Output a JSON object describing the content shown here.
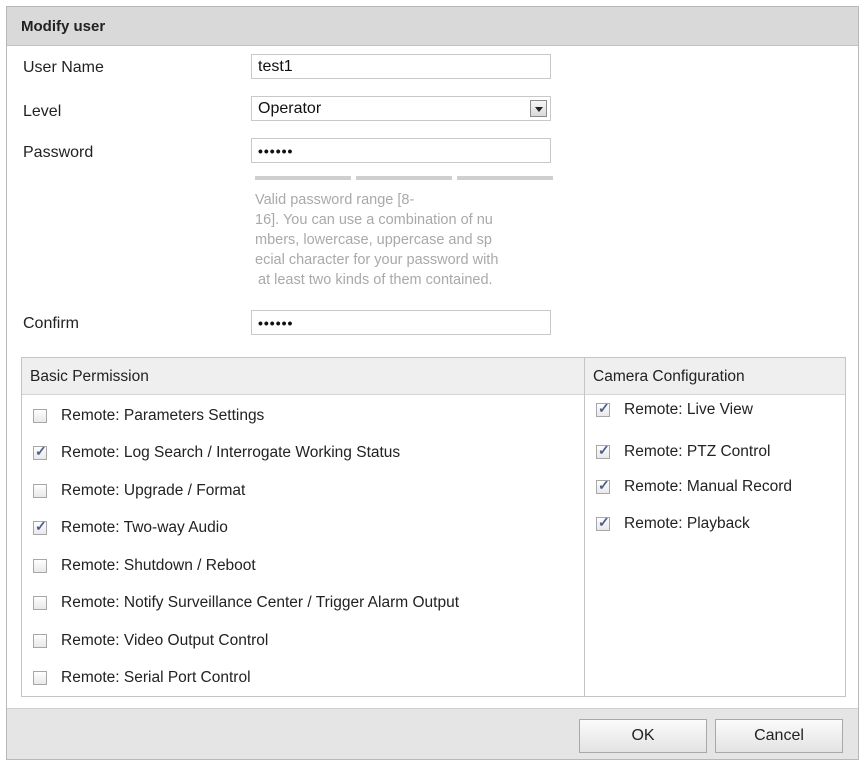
{
  "dialog": {
    "title": "Modify user"
  },
  "form": {
    "user_name": {
      "label": "User Name",
      "value": "test1"
    },
    "level": {
      "label": "Level",
      "value": "Operator"
    },
    "password": {
      "label": "Password",
      "value": "••••••"
    },
    "password_hint_lines": [
      "Valid password range [8-",
      "16]. You can use a combination of nu",
      "mbers, lowercase, uppercase and sp",
      "ecial character for your password with",
      "at least two kinds of them contained."
    ],
    "confirm": {
      "label": "Confirm",
      "value": "••••••"
    }
  },
  "basic_permission": {
    "header": "Basic Permission",
    "items": [
      {
        "label": "Remote: Parameters Settings",
        "checked": false
      },
      {
        "label": "Remote: Log Search / Interrogate Working Status",
        "checked": true
      },
      {
        "label": "Remote: Upgrade / Format",
        "checked": false
      },
      {
        "label": "Remote: Two-way Audio",
        "checked": true
      },
      {
        "label": "Remote: Shutdown / Reboot",
        "checked": false
      },
      {
        "label": "Remote: Notify Surveillance Center / Trigger Alarm Output",
        "checked": false
      },
      {
        "label": "Remote: Video Output Control",
        "checked": false
      },
      {
        "label": "Remote: Serial Port Control",
        "checked": false
      }
    ]
  },
  "camera_configuration": {
    "header": "Camera Configuration",
    "items": [
      {
        "label": "Remote: Live View",
        "checked": true
      },
      {
        "label": "Remote: PTZ Control",
        "checked": true
      },
      {
        "label": "Remote: Manual Record",
        "checked": true
      },
      {
        "label": "Remote: Playback",
        "checked": true
      }
    ]
  },
  "buttons": {
    "ok": "OK",
    "cancel": "Cancel"
  }
}
